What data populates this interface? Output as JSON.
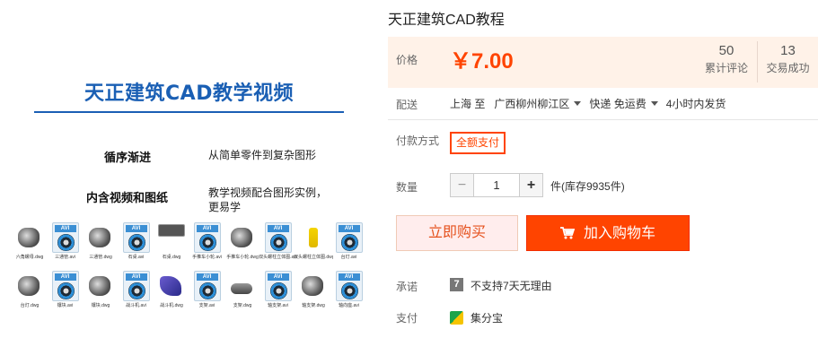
{
  "hero": {
    "title": "天正建筑CAD教学视频",
    "features": [
      {
        "title": "循序渐进",
        "desc": "从简单零件到复杂图形"
      },
      {
        "title": "内含视频和图纸",
        "desc": "教学视频配合图形实例，\n更易学"
      }
    ],
    "thumbnails": [
      {
        "kind": "cad",
        "label": "六角螺母.dwg"
      },
      {
        "kind": "avi",
        "label": "三通管.avi"
      },
      {
        "kind": "cad",
        "label": "三通管.dwg"
      },
      {
        "kind": "avi",
        "label": "石桌.avi"
      },
      {
        "kind": "cad-dark",
        "label": "石桌.dwg"
      },
      {
        "kind": "avi",
        "label": "手推车小轮.avi"
      },
      {
        "kind": "cad",
        "label": "手推车小轮.dwg"
      },
      {
        "kind": "avi",
        "label": "双头螺柱立体图.avi"
      },
      {
        "kind": "cad-yellow",
        "label": "双头螺柱立体图.dwg"
      },
      {
        "kind": "avi",
        "label": "台灯.avi"
      },
      {
        "kind": "cad",
        "label": "台灯.dwg"
      },
      {
        "kind": "avi",
        "label": "镶块.avi"
      },
      {
        "kind": "cad",
        "label": "镶块.dwg"
      },
      {
        "kind": "avi",
        "label": "战斗机.avi"
      },
      {
        "kind": "cad-blue",
        "label": "战斗机.dwg"
      },
      {
        "kind": "avi",
        "label": "支架.avi"
      },
      {
        "kind": "cad-flat",
        "label": "支架.dwg"
      },
      {
        "kind": "avi",
        "label": "轴支架.avi"
      },
      {
        "kind": "cad",
        "label": "轴支架.dwg"
      },
      {
        "kind": "avi",
        "label": "轴向座.avi"
      }
    ]
  },
  "product": {
    "title": "天正建筑CAD教程",
    "price_label": "价格",
    "price": "￥7.00",
    "stats": [
      {
        "value": "50",
        "caption": "累计评论"
      },
      {
        "value": "13",
        "caption": "交易成功"
      }
    ],
    "delivery": {
      "label": "配送",
      "from": "上海 至",
      "to": "广西柳州柳江区",
      "shipping": "快递 免运费",
      "ship_time": "4小时内发货"
    },
    "payment": {
      "label": "付款方式",
      "option": "全额支付"
    },
    "quantity": {
      "label": "数量",
      "value": "1",
      "minus": "−",
      "plus": "+",
      "stock": "件(库存9935件)"
    },
    "buy_now": "立即购买",
    "add_to_cart": "加入购物车",
    "promise": {
      "label": "承诺",
      "icon_char": "7",
      "text": "不支持7天无理由"
    },
    "pay_methods": {
      "label": "支付",
      "text": "集分宝"
    }
  },
  "colors": {
    "accent": "#ff4400",
    "price_bg": "#fff2e8",
    "hero_blue": "#1a5fb4"
  },
  "icons": {
    "cart": "shopping-cart-icon",
    "caret": "chevron-down-icon",
    "promise": "seven-day-icon",
    "pay": "jifenbao-icon"
  }
}
